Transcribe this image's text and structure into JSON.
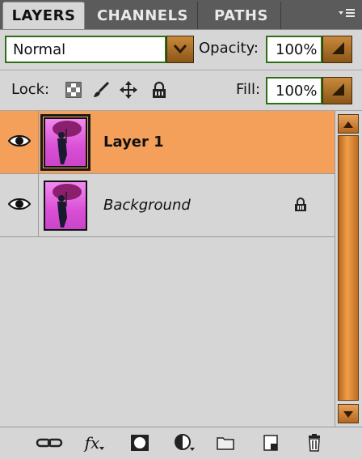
{
  "tabs": [
    {
      "label": "LAYERS",
      "active": true
    },
    {
      "label": "CHANNELS",
      "active": false
    },
    {
      "label": "PATHS",
      "active": false
    }
  ],
  "panel_menu_icon": "panel-menu-icon",
  "blend": {
    "mode": "Normal",
    "dropdown_icon": "chevron-down-icon"
  },
  "opacity": {
    "label": "Opacity:",
    "value": "100%"
  },
  "lock": {
    "label": "Lock:",
    "icons": [
      "lock-transparent-pixels-icon",
      "lock-image-pixels-icon",
      "lock-position-icon",
      "lock-all-icon"
    ]
  },
  "fill": {
    "label": "Fill:",
    "value": "100%"
  },
  "layers": [
    {
      "name": "Layer 1",
      "visible": true,
      "selected": true,
      "locked": false
    },
    {
      "name": "Background",
      "visible": true,
      "selected": false,
      "locked": true
    }
  ],
  "bottom_tools": [
    "link-layers-icon",
    "layer-style-fx-icon",
    "add-mask-icon",
    "adjustment-layer-icon",
    "new-group-folder-icon",
    "new-layer-icon",
    "delete-layer-trash-icon"
  ],
  "fx_label": "fx",
  "colors": {
    "accent_orange": "#f5a05a",
    "field_border_green": "#2f6d18",
    "panel_bg": "#d6d6d6",
    "tab_bg": "#5b5b5b"
  }
}
